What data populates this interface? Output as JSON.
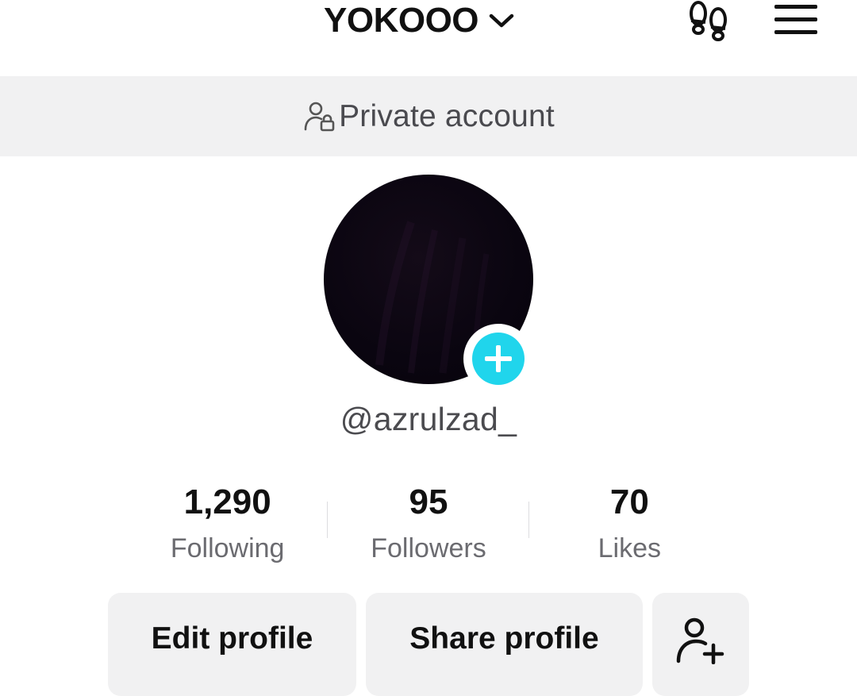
{
  "header": {
    "account_name": "YOKOOO",
    "chevron_icon": "chevron-down-icon",
    "footprints_icon": "footprints-icon",
    "menu_icon": "hamburger-menu-icon"
  },
  "banner": {
    "icon": "private-account-icon",
    "text": "Private account"
  },
  "profile": {
    "username": "@azrulzad_",
    "add_icon": "plus-icon",
    "add_color": "#20d5ec"
  },
  "stats": [
    {
      "value": "1,290",
      "label": "Following"
    },
    {
      "value": "95",
      "label": "Followers"
    },
    {
      "value": "70",
      "label": "Likes"
    }
  ],
  "actions": {
    "edit_profile": "Edit profile",
    "share_profile": "Share profile",
    "add_friend_icon": "add-friend-icon"
  }
}
